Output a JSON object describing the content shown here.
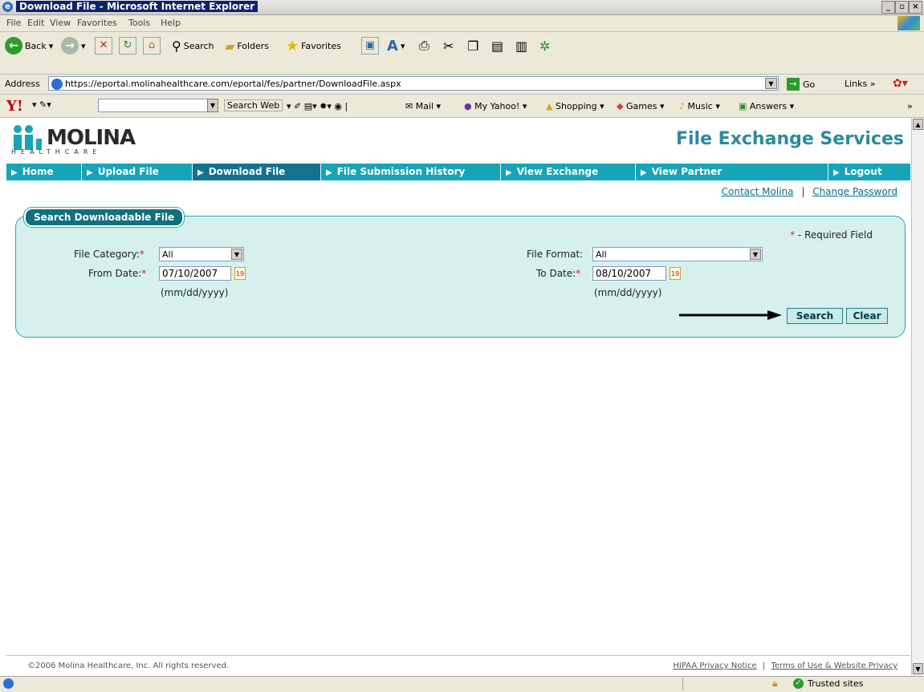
{
  "window": {
    "title": "Download File - Microsoft Internet Explorer"
  },
  "menu": [
    "File",
    "Edit",
    "View",
    "Favorites",
    "Tools",
    "Help"
  ],
  "toolbar": {
    "back": "Back",
    "search": "Search",
    "folders": "Folders",
    "favorites": "Favorites"
  },
  "address": {
    "label": "Address",
    "url": "https://eportal.molinahealthcare.com/eportal/fes/partner/DownloadFile.aspx",
    "go": "Go",
    "links": "Links"
  },
  "yahoo": {
    "search_web": "Search Web",
    "mail": "Mail",
    "my_yahoo": "My Yahoo!",
    "shopping": "Shopping",
    "games": "Games",
    "music": "Music",
    "answers": "Answers"
  },
  "header": {
    "logo": "MOLINA",
    "logo_sub": "HEALTHCARE",
    "site_title": "File Exchange Services"
  },
  "nav": [
    {
      "label": "Home"
    },
    {
      "label": "Upload File"
    },
    {
      "label": "Download File"
    },
    {
      "label": "File Submission History"
    },
    {
      "label": "View Exchange"
    },
    {
      "label": "View Partner"
    },
    {
      "label": "Logout"
    }
  ],
  "top_links": {
    "contact": "Contact Molina",
    "sep": "|",
    "change_password": "Change Password"
  },
  "panel": {
    "title": "Search Downloadable File",
    "required_star": "*",
    "required_note": "- Required Field",
    "file_category_label": "File Category:",
    "file_category_value": "All",
    "from_date_label": "From Date:",
    "from_date_value": "07/10/2007",
    "from_date_hint": "(mm/dd/yyyy)",
    "file_format_label": "File Format:",
    "file_format_value": "All",
    "to_date_label": "To Date:",
    "to_date_value": "08/10/2007",
    "to_date_hint": "(mm/dd/yyyy)",
    "search_button": "Search",
    "clear_button": "Clear",
    "calendar_day": "19"
  },
  "footer": {
    "copyright": "©2006 Molina Healthcare, Inc. All rights reserved.",
    "hipaa": "HIPAA Privacy Notice",
    "sep": "|",
    "terms": "Terms of Use & Website Privacy"
  },
  "status": {
    "zone": "Trusted sites"
  }
}
